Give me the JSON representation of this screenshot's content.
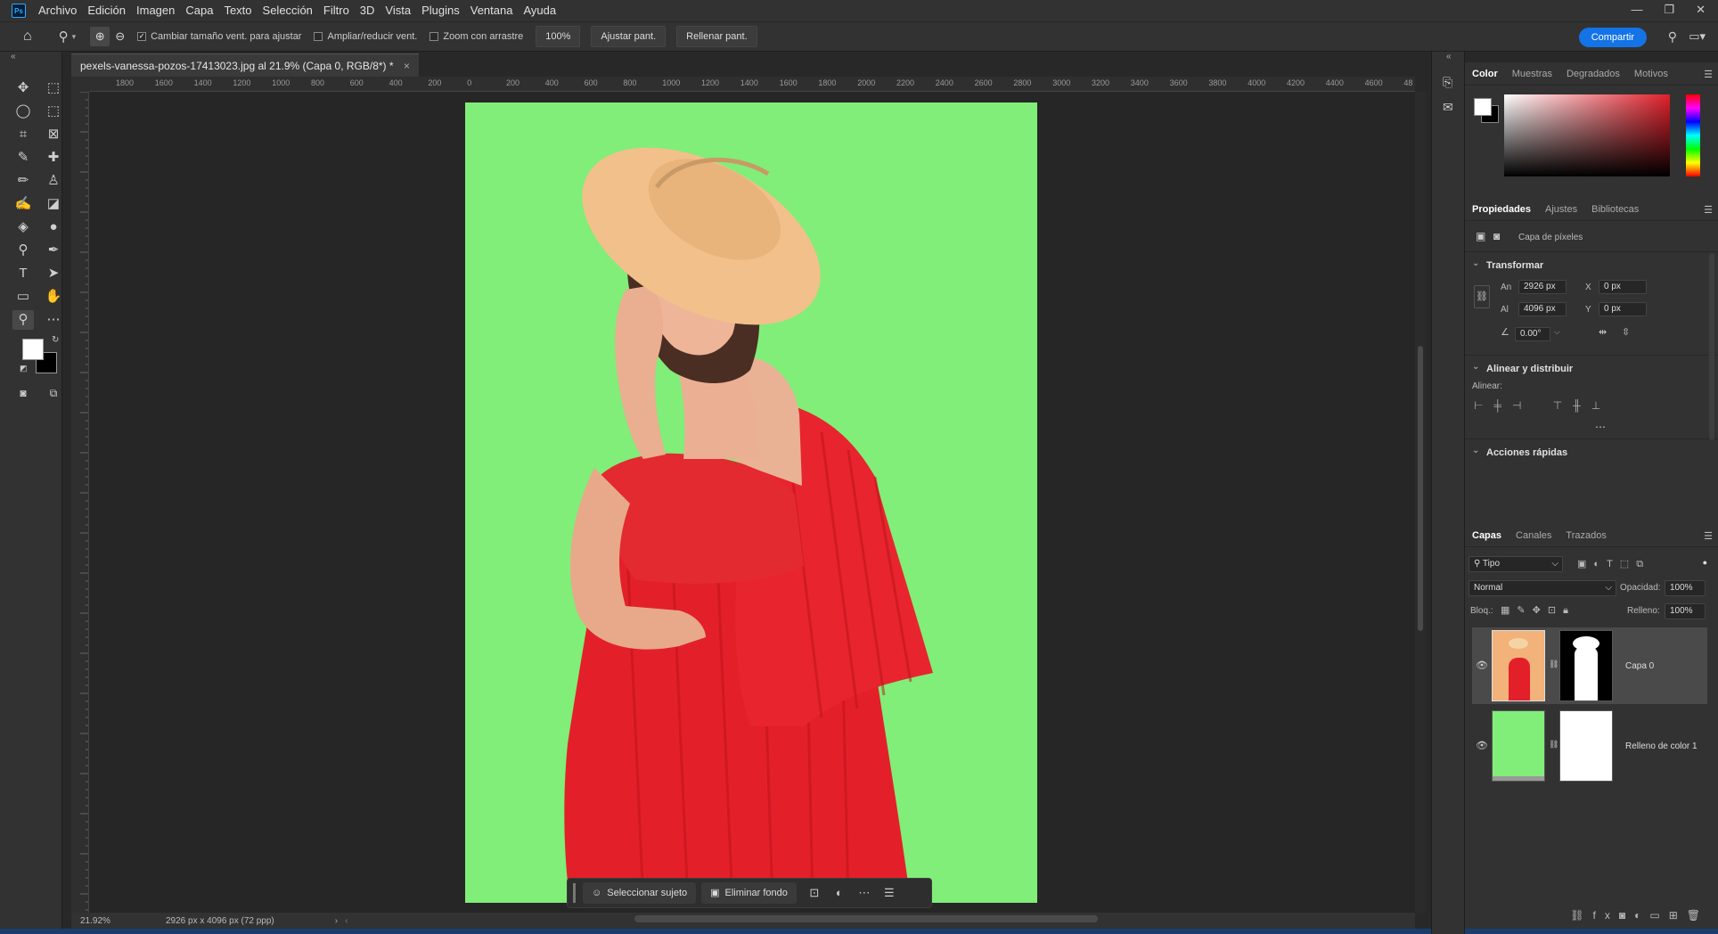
{
  "menu": {
    "app_icon": "Ps",
    "items": [
      "Archivo",
      "Edición",
      "Imagen",
      "Capa",
      "Texto",
      "Selección",
      "Filtro",
      "3D",
      "Vista",
      "Plugins",
      "Ventana",
      "Ayuda"
    ]
  },
  "window": {
    "minimize": "—",
    "restore": "❐",
    "close": "✕"
  },
  "options": {
    "resize_windows": "Cambiar tamaño vent. para ajustar",
    "zoom_all": "Ampliar/reducir vent.",
    "scrubby_zoom": "Zoom con arrastre",
    "zoom_value": "100%",
    "fit_screen": "Ajustar pant.",
    "fill_screen": "Rellenar pant.",
    "share": "Compartir"
  },
  "document": {
    "tab_title": "pexels-vanessa-pozos-17413023.jpg al 21.9% (Capa 0, RGB/8*) *",
    "tab_close": "×",
    "ruler_labels": [
      "1800",
      "1600",
      "1400",
      "1200",
      "1000",
      "800",
      "600",
      "400",
      "200",
      "0",
      "200",
      "400",
      "600",
      "800",
      "1000",
      "1200",
      "1400",
      "1600",
      "1800",
      "2000",
      "2200",
      "2400",
      "2600",
      "2800",
      "3000",
      "3200",
      "3400",
      "3600",
      "3800",
      "4000",
      "4200",
      "4400",
      "4600",
      "48"
    ],
    "fill_color": "#80ee78"
  },
  "context_bar": {
    "select_subject": "Seleccionar sujeto",
    "remove_bg": "Eliminar fondo"
  },
  "status": {
    "zoom": "21.92%",
    "size": "2926 px x 4096 px (72 ppp)"
  },
  "color_panel": {
    "tabs": [
      "Color",
      "Muestras",
      "Degradados",
      "Motivos"
    ],
    "fg": "#ffffff",
    "bg": "#000000",
    "hue": "#e0202a"
  },
  "properties": {
    "tabs": [
      "Propiedades",
      "Ajustes",
      "Bibliotecas"
    ],
    "kind": "Capa de píxeles",
    "transform_title": "Transformar",
    "w_label": "An",
    "w_value": "2926 px",
    "h_label": "Al",
    "h_value": "4096 px",
    "x_label": "X",
    "x_value": "0 px",
    "y_label": "Y",
    "y_value": "0 px",
    "angle": "0.00°",
    "align_title": "Alinear y distribuir",
    "align_label": "Alinear:",
    "quick_title": "Acciones rápidas"
  },
  "layers": {
    "tabs": [
      "Capas",
      "Canales",
      "Trazados"
    ],
    "filter": "Tipo",
    "blend": "Normal",
    "opacity_label": "Opacidad:",
    "opacity": "100%",
    "lock_label": "Bloq.:",
    "fill_label": "Relleno:",
    "fill": "100%",
    "items": [
      {
        "name": "Capa 0"
      },
      {
        "name": "Relleno de color 1"
      }
    ]
  }
}
